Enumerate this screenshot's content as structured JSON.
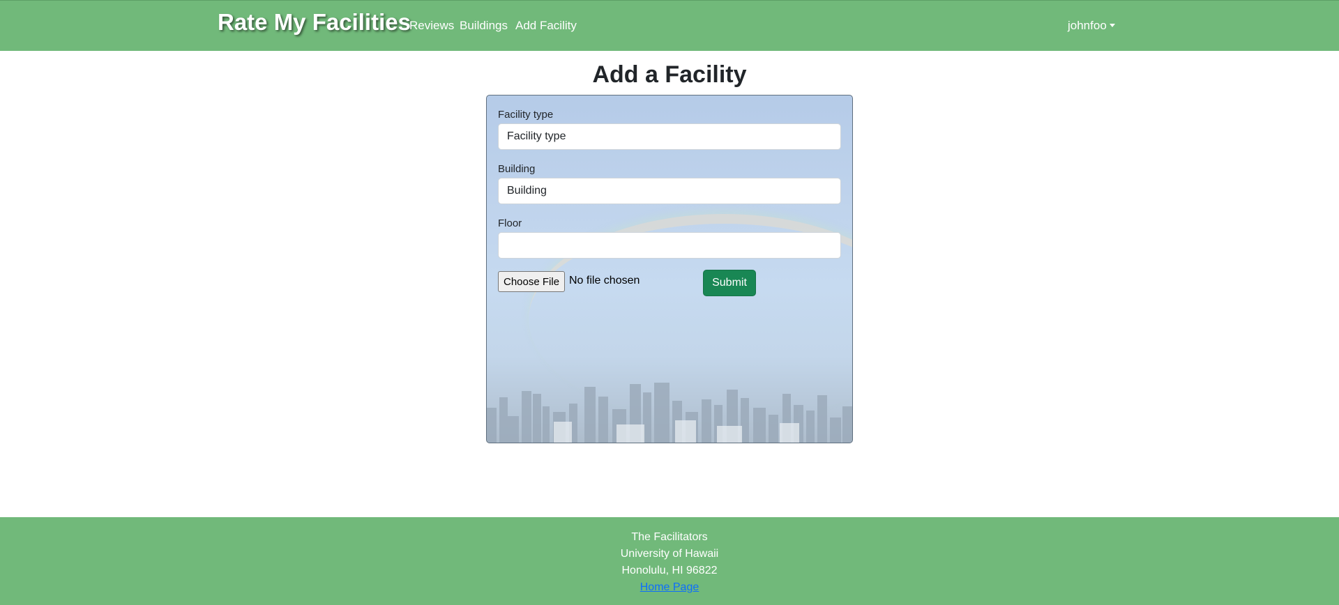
{
  "navbar": {
    "brand": "Rate My Facilities",
    "links": [
      "Reviews",
      "Buildings",
      "Add Facility"
    ],
    "user": "johnfoo",
    "background_color": "#71b97a"
  },
  "page": {
    "title": "Add a Facility"
  },
  "form": {
    "facility_type": {
      "label": "Facility type",
      "placeholder": "Facility type",
      "value": ""
    },
    "building": {
      "label": "Building",
      "placeholder": "Building",
      "value": ""
    },
    "floor": {
      "label": "Floor",
      "placeholder": "",
      "value": ""
    },
    "file": {
      "button_label": "Choose File",
      "status": "No file chosen"
    },
    "submit_label": "Submit",
    "submit_color": "#198754"
  },
  "footer": {
    "lines": [
      "The Facilitators",
      "University of Hawaii",
      "Honolulu, HI 96822"
    ],
    "link_text": "Home Page"
  }
}
